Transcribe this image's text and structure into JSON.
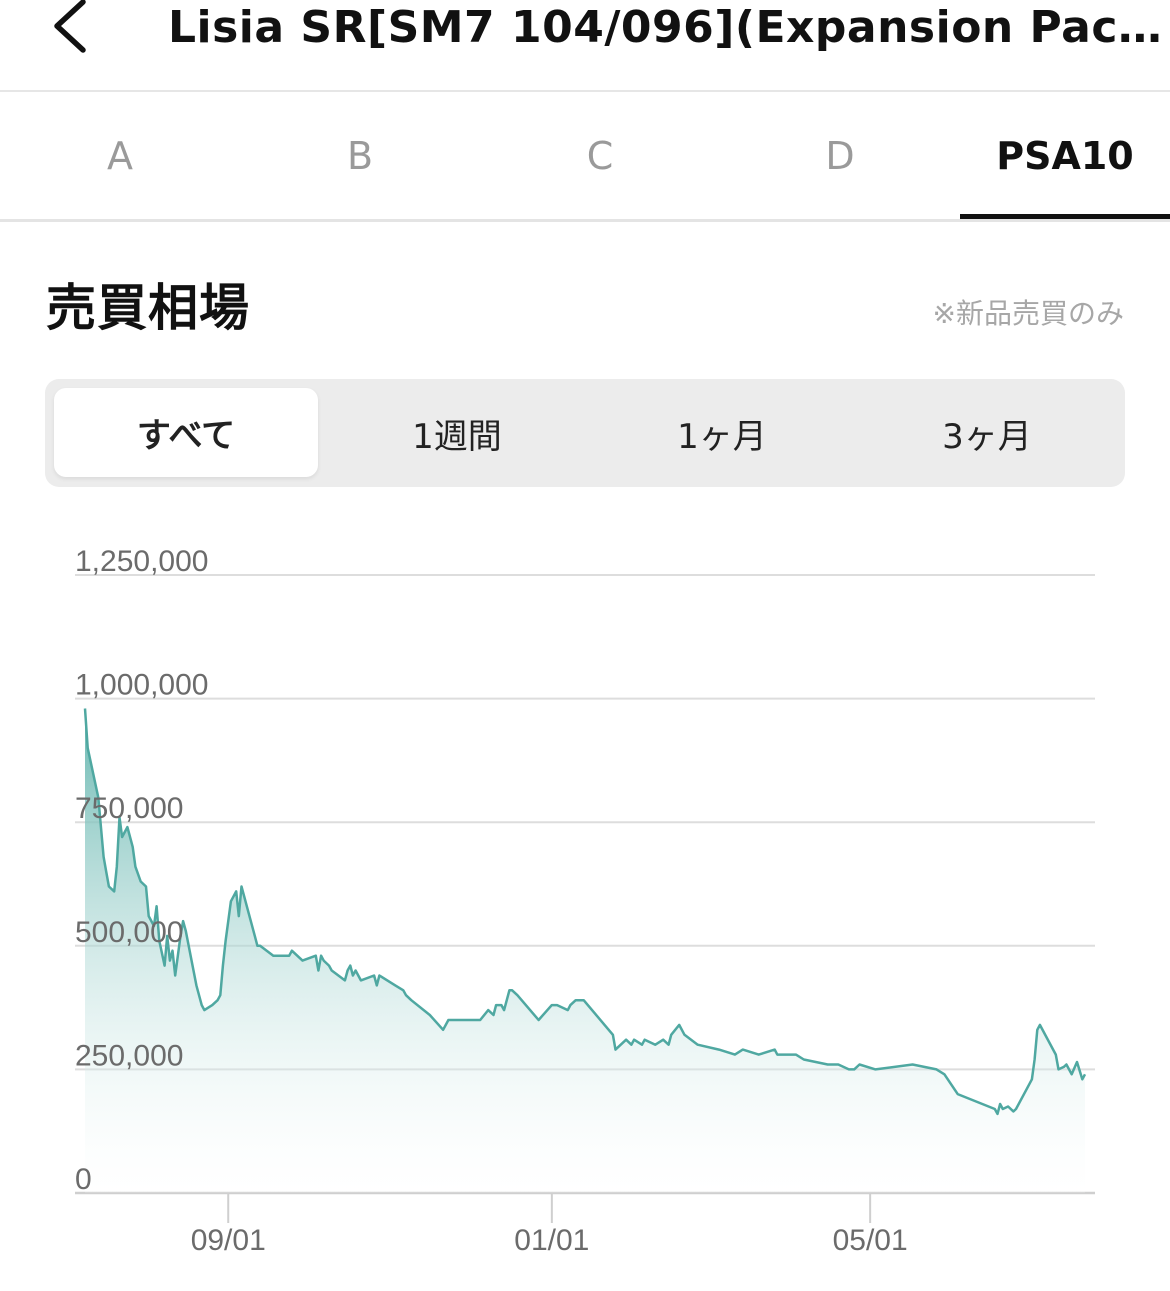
{
  "header": {
    "title": "Lisia SR[SM7 104/096](Expansion Pack …"
  },
  "grade_tabs": [
    {
      "label": "A",
      "active": false
    },
    {
      "label": "B",
      "active": false
    },
    {
      "label": "C",
      "active": false
    },
    {
      "label": "D",
      "active": false
    },
    {
      "label": "PSA10",
      "active": true
    }
  ],
  "section": {
    "title": "売買相場",
    "note": "※新品売買のみ"
  },
  "periods": [
    {
      "label": "すべて",
      "active": true
    },
    {
      "label": "1週間",
      "active": false
    },
    {
      "label": "1ヶ月",
      "active": false
    },
    {
      "label": "3ヶ月",
      "active": false
    }
  ],
  "colors": {
    "line": "#4fa8a1",
    "fill_top": "#5fb3ac",
    "grid": "#dddddd",
    "axis_text": "#6b6b6b"
  },
  "chart_data": {
    "type": "area",
    "ylim": [
      0,
      1250000
    ],
    "y_ticks": [
      0,
      250000,
      500000,
      750000,
      1000000,
      1250000
    ],
    "y_tick_labels": [
      "0",
      "250,000",
      "500,000",
      "750,000",
      "1,000,000",
      "1,250,000"
    ],
    "x_range": [
      "2022-07-09",
      "2023-07-21"
    ],
    "x_ticks": [
      "2022-09-01",
      "2023-01-01",
      "2023-05-01"
    ],
    "x_tick_labels": [
      "09/01",
      "01/01",
      "05/01"
    ],
    "grid": true,
    "series": [
      {
        "x": [
          "2022-07-09",
          "2022-07-10",
          "2022-07-14",
          "2022-07-16",
          "2022-07-17",
          "2022-07-18",
          "2022-07-20",
          "2022-07-21",
          "2022-07-22",
          "2022-07-23",
          "2022-07-25",
          "2022-07-27",
          "2022-07-28",
          "2022-07-30",
          "2022-08-01",
          "2022-08-02",
          "2022-08-04",
          "2022-08-05",
          "2022-08-06",
          "2022-08-08",
          "2022-08-09",
          "2022-08-10",
          "2022-08-11",
          "2022-08-12",
          "2022-08-14",
          "2022-08-15",
          "2022-08-16",
          "2022-08-20",
          "2022-08-22",
          "2022-08-23",
          "2022-08-26",
          "2022-08-28",
          "2022-08-29",
          "2022-08-30",
          "2022-08-31",
          "2022-09-02",
          "2022-09-04",
          "2022-09-05",
          "2022-09-06",
          "2022-09-07",
          "2022-09-08",
          "2022-09-11",
          "2022-09-12",
          "2022-09-13",
          "2022-09-18",
          "2022-09-24",
          "2022-09-25",
          "2022-09-29",
          "2022-10-04",
          "2022-10-05",
          "2022-10-06",
          "2022-10-07",
          "2022-10-09",
          "2022-10-10",
          "2022-10-15",
          "2022-10-16",
          "2022-10-17",
          "2022-10-18",
          "2022-10-19",
          "2022-10-21",
          "2022-10-26",
          "2022-10-27",
          "2022-10-28",
          "2022-11-03",
          "2022-11-06",
          "2022-11-07",
          "2022-11-09",
          "2022-11-16",
          "2022-11-21",
          "2022-11-23",
          "2022-11-30",
          "2022-12-05",
          "2022-12-08",
          "2022-12-10",
          "2022-12-11",
          "2022-12-13",
          "2022-12-14",
          "2022-12-16",
          "2022-12-17",
          "2022-12-19",
          "2022-12-27",
          "2023-01-01",
          "2023-01-03",
          "2023-01-07",
          "2023-01-08",
          "2023-01-10",
          "2023-01-13",
          "2023-01-24",
          "2023-01-25",
          "2023-01-29",
          "2023-01-31",
          "2023-02-01",
          "2023-02-04",
          "2023-02-05",
          "2023-02-09",
          "2023-02-12",
          "2023-02-14",
          "2023-02-15",
          "2023-02-18",
          "2023-02-20",
          "2023-02-25",
          "2023-03-05",
          "2023-03-11",
          "2023-03-14",
          "2023-03-20",
          "2023-03-26",
          "2023-03-27",
          "2023-04-03",
          "2023-04-06",
          "2023-04-15",
          "2023-04-19",
          "2023-04-23",
          "2023-04-25",
          "2023-04-27",
          "2023-05-03",
          "2023-05-17",
          "2023-05-26",
          "2023-05-29",
          "2023-06-03",
          "2023-06-17",
          "2023-06-18",
          "2023-06-19",
          "2023-06-20",
          "2023-06-22",
          "2023-06-24",
          "2023-06-25",
          "2023-06-30",
          "2023-07-01",
          "2023-07-02",
          "2023-07-03",
          "2023-07-04",
          "2023-07-10",
          "2023-07-11",
          "2023-07-13",
          "2023-07-14",
          "2023-07-16",
          "2023-07-18",
          "2023-07-20",
          "2023-07-21"
        ],
        "values": [
          980000,
          900000,
          800000,
          680000,
          650000,
          620000,
          610000,
          660000,
          760000,
          720000,
          740000,
          700000,
          660000,
          630000,
          620000,
          560000,
          540000,
          580000,
          510000,
          460000,
          520000,
          470000,
          490000,
          440000,
          520000,
          550000,
          530000,
          420000,
          380000,
          370000,
          380000,
          390000,
          400000,
          460000,
          510000,
          590000,
          610000,
          560000,
          620000,
          600000,
          580000,
          520000,
          500000,
          500000,
          480000,
          480000,
          490000,
          470000,
          480000,
          450000,
          480000,
          470000,
          460000,
          450000,
          430000,
          450000,
          460000,
          440000,
          450000,
          430000,
          440000,
          420000,
          440000,
          420000,
          410000,
          400000,
          390000,
          360000,
          330000,
          350000,
          350000,
          350000,
          370000,
          360000,
          380000,
          380000,
          370000,
          410000,
          410000,
          400000,
          350000,
          380000,
          380000,
          370000,
          380000,
          390000,
          390000,
          320000,
          290000,
          310000,
          300000,
          310000,
          300000,
          310000,
          300000,
          310000,
          300000,
          320000,
          340000,
          320000,
          300000,
          290000,
          280000,
          290000,
          280000,
          290000,
          280000,
          280000,
          270000,
          260000,
          260000,
          250000,
          250000,
          260000,
          250000,
          260000,
          250000,
          240000,
          200000,
          170000,
          160000,
          180000,
          170000,
          175000,
          165000,
          170000,
          220000,
          230000,
          270000,
          330000,
          340000,
          280000,
          250000,
          255000,
          260000,
          240000,
          265000,
          230000,
          240000
        ],
        "color": "#4fa8a1"
      }
    ]
  }
}
